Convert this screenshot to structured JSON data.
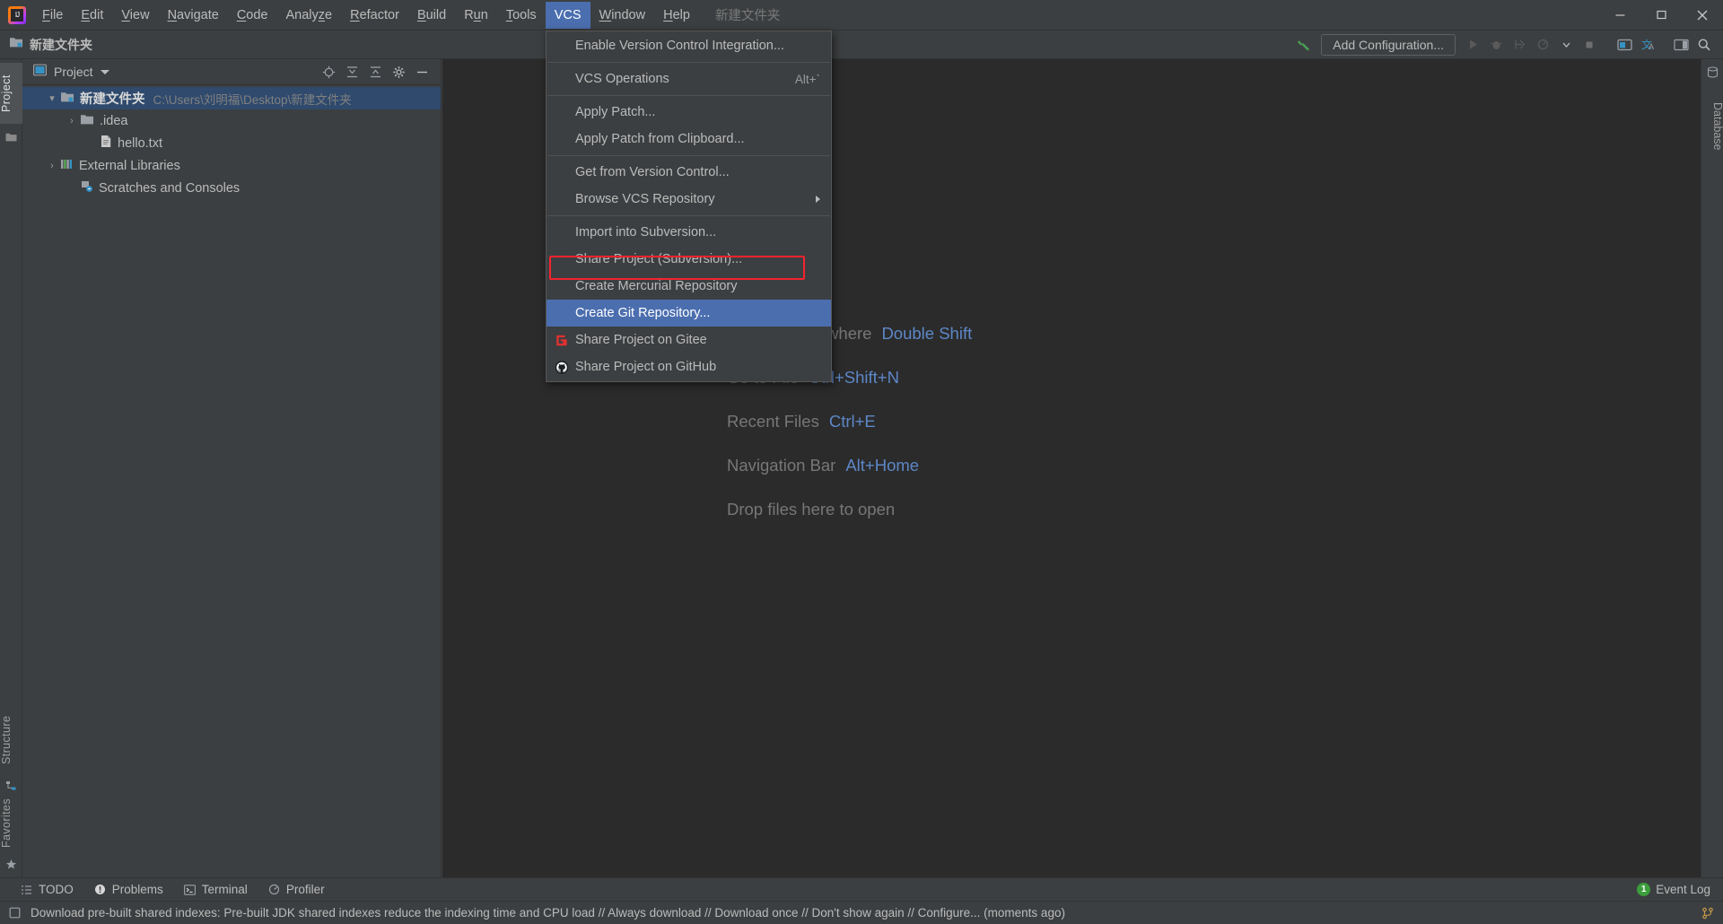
{
  "app": {
    "logo_icon": "intellij-idea-logo",
    "project_chip": "新建文件夹"
  },
  "menubar": {
    "items": [
      {
        "label": "File",
        "mnemonic": "F"
      },
      {
        "label": "Edit",
        "mnemonic": "E"
      },
      {
        "label": "View",
        "mnemonic": "V"
      },
      {
        "label": "Navigate",
        "mnemonic": "N"
      },
      {
        "label": "Code",
        "mnemonic": "C"
      },
      {
        "label": "Analyze",
        "mnemonic": "z"
      },
      {
        "label": "Refactor",
        "mnemonic": "R"
      },
      {
        "label": "Build",
        "mnemonic": "B"
      },
      {
        "label": "Run",
        "mnemonic": "u"
      },
      {
        "label": "Tools",
        "mnemonic": "T"
      },
      {
        "label": "VCS",
        "mnemonic": "",
        "active": true
      },
      {
        "label": "Window",
        "mnemonic": "W"
      },
      {
        "label": "Help",
        "mnemonic": "H"
      }
    ]
  },
  "window_controls": {
    "minimize": "minimize-icon",
    "maximize": "maximize-icon",
    "close": "close-icon"
  },
  "navbar": {
    "crumb_icon": "module-folder-icon",
    "crumb_label": "新建文件夹",
    "hammer_icon": "build-hammer-icon",
    "add_configuration_label": "Add Configuration...",
    "run_icon": "run-icon",
    "debug_icon": "debug-icon",
    "coverage_icon": "run-with-coverage-icon",
    "profile_icon": "profile-icon",
    "profile_dropdown_icon": "chevron-down-icon",
    "stop_icon": "stop-icon",
    "updates_icon": "ide-updates-icon",
    "translate_icon": "translate-icon",
    "layout_icon": "toggle-layout-icon",
    "search_icon": "search-icon"
  },
  "left_strip": {
    "project_tab": "Project",
    "structure_tab": "Structure",
    "favorites_tab": "Favorites",
    "project_icon": "folder-icon",
    "structure_icon": "structure-icon",
    "favorites_icon": "star-icon"
  },
  "right_strip": {
    "database_tab": "Database",
    "database_icon": "database-icon"
  },
  "project_panel": {
    "header_icon": "project-view-icon",
    "title": "Project",
    "caret_icon": "chevron-down-icon",
    "actions": [
      {
        "name": "select-opened-file-icon",
        "label": "Select Opened File"
      },
      {
        "name": "expand-all-icon",
        "label": "Expand All"
      },
      {
        "name": "collapse-all-icon",
        "label": "Collapse All"
      },
      {
        "name": "gear-icon",
        "label": "Settings"
      },
      {
        "name": "hide-icon",
        "label": "Hide"
      }
    ],
    "tree": [
      {
        "label": "新建文件夹",
        "path": "C:\\Users\\刘明福\\Desktop\\新建文件夹",
        "icon": "module-folder-icon",
        "arrow": "expanded",
        "selected": true,
        "indent": 0
      },
      {
        "label": ".idea",
        "path": "",
        "icon": "folder-icon",
        "arrow": "collapsed",
        "selected": false,
        "indent": 1
      },
      {
        "label": "hello.txt",
        "path": "",
        "icon": "text-file-icon",
        "arrow": "none",
        "selected": false,
        "indent": 2
      },
      {
        "label": "External Libraries",
        "path": "",
        "icon": "libraries-icon",
        "arrow": "collapsed",
        "selected": false,
        "indent": 0
      },
      {
        "label": "Scratches and Consoles",
        "path": "",
        "icon": "scratches-icon",
        "arrow": "none",
        "selected": false,
        "indent": 1
      }
    ]
  },
  "vcs_menu": {
    "items": [
      {
        "label": "Enable Version Control Integration...",
        "mnemonic": "E",
        "icon": "",
        "shortcut": "",
        "type": "item"
      },
      {
        "type": "separator"
      },
      {
        "label": "VCS Operations",
        "mnemonic": "",
        "icon": "",
        "shortcut": "Alt+`",
        "type": "item"
      },
      {
        "type": "separator"
      },
      {
        "label": "Apply Patch...",
        "mnemonic": "",
        "icon": "",
        "shortcut": "",
        "type": "item"
      },
      {
        "label": "Apply Patch from Clipboard...",
        "mnemonic": "",
        "icon": "",
        "shortcut": "",
        "type": "item"
      },
      {
        "type": "separator"
      },
      {
        "label": "Get from Version Control...",
        "mnemonic": "",
        "icon": "",
        "shortcut": "",
        "type": "item"
      },
      {
        "label": "Browse VCS Repository",
        "mnemonic": "",
        "icon": "",
        "shortcut": "",
        "type": "submenu"
      },
      {
        "type": "separator"
      },
      {
        "label": "Import into Subversion...",
        "mnemonic": "m",
        "icon": "",
        "shortcut": "",
        "type": "item"
      },
      {
        "label": "Share Project (Subversion)...",
        "mnemonic": "",
        "icon": "",
        "shortcut": "",
        "type": "item"
      },
      {
        "label": "Create Mercurial Repository",
        "mnemonic": "",
        "icon": "",
        "shortcut": "",
        "type": "item"
      },
      {
        "label": "Create Git Repository...",
        "mnemonic": "",
        "icon": "",
        "shortcut": "",
        "type": "item",
        "selected": true
      },
      {
        "label": "Share Project on Gitee",
        "mnemonic": "",
        "icon": "gitee-icon",
        "shortcut": "",
        "type": "item"
      },
      {
        "label": "Share Project on GitHub",
        "mnemonic": "",
        "icon": "github-icon",
        "shortcut": "",
        "type": "item"
      }
    ],
    "highlight_color": "#f4232e",
    "selection_color": "#4b6eaf"
  },
  "editor": {
    "hints": [
      {
        "label": "Search Everywhere",
        "key": "Double Shift"
      },
      {
        "label": "Go to File",
        "key": "Ctrl+Shift+N"
      },
      {
        "label": "Recent Files",
        "key": "Ctrl+E"
      },
      {
        "label": "Navigation Bar",
        "key": "Alt+Home"
      },
      {
        "label": "Drop files here to open",
        "key": ""
      }
    ]
  },
  "bottom_bar": {
    "items": [
      {
        "label": "TODO",
        "icon": "todo-icon"
      },
      {
        "label": "Problems",
        "icon": "problems-icon"
      },
      {
        "label": "Terminal",
        "icon": "terminal-icon"
      },
      {
        "label": "Profiler",
        "icon": "profiler-icon"
      }
    ],
    "event_log_label": "Event Log",
    "event_log_count": "1"
  },
  "status_bar": {
    "icon": "memory-indicator-icon",
    "message": "Download pre-built shared indexes: Pre-built JDK shared indexes reduce the indexing time and CPU load // Always download // Download once // Don't show again // Configure... (moments ago)",
    "right_icon": "git-branch-icon"
  }
}
